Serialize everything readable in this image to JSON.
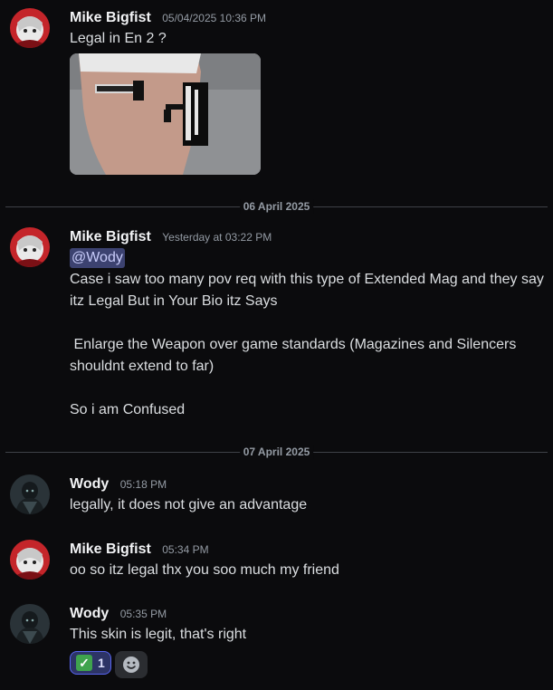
{
  "messages": [
    {
      "author": "Mike Bigfist",
      "time": "05/04/2025 10:36 PM",
      "text": "Legal in En 2 ?",
      "attachment_alt": "image"
    },
    {
      "author": "Mike Bigfist",
      "time": "Yesterday at 03:22 PM",
      "mention": "@Wody",
      "text1": "Case i saw too many pov req with this type of Extended Mag and they say itz Legal But in Your Bio itz Says",
      "text2": " Enlarge the Weapon over game standards (Magazines and Silencers shouldnt extend to far)",
      "text3": "So i am Confused"
    },
    {
      "author": "Wody",
      "time": "05:18 PM",
      "text": "legally, it does not give an advantage"
    },
    {
      "author": "Mike Bigfist",
      "time": "05:34 PM",
      "text": "oo so itz legal thx you soo much my friend"
    },
    {
      "author": "Wody",
      "time": "05:35 PM",
      "text": "This skin is legit, that's right",
      "reaction": {
        "emoji": "✓",
        "emoji_icon": "check-mark-button-icon",
        "count": "1"
      },
      "add_reaction_icon": "smiley-icon"
    }
  ],
  "dividers": [
    "06 April 2025",
    "07 April 2025"
  ],
  "colors": {
    "background": "#0b0b0d",
    "author": "#f2f3f5",
    "timestamp": "#949ba4",
    "mention_bg": "#3c4270",
    "reaction_border": "#5865f2"
  }
}
